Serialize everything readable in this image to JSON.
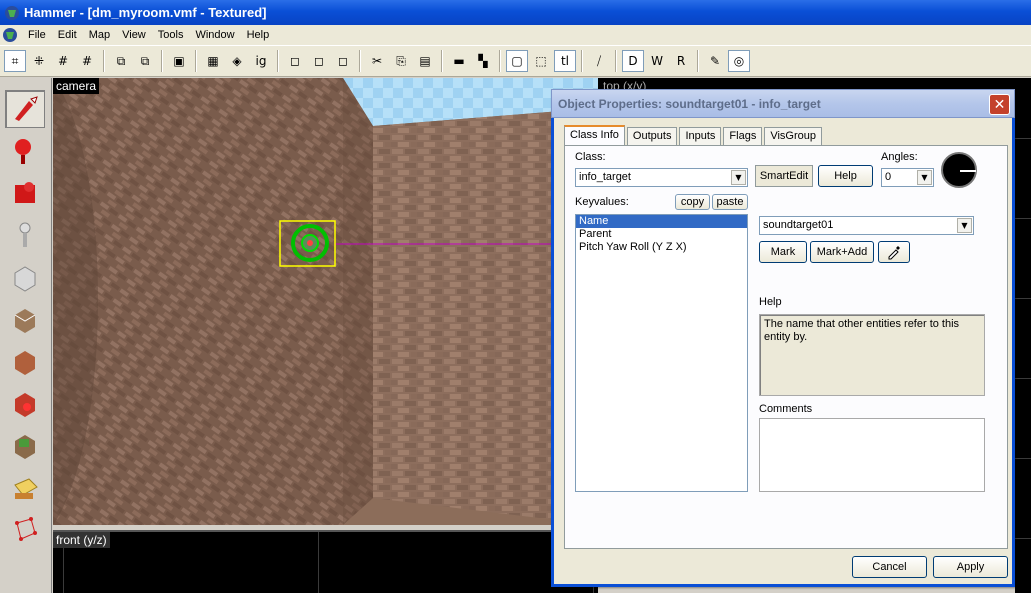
{
  "window": {
    "title": "Hammer - [dm_myroom.vmf - Textured]"
  },
  "menu": {
    "items": [
      "File",
      "Edit",
      "Map",
      "View",
      "Tools",
      "Window",
      "Help"
    ]
  },
  "toolbar": {
    "buttons": [
      {
        "name": "grid-toggle-icon",
        "glyph": "⌗",
        "pressed": true
      },
      {
        "name": "grid-dots-icon",
        "glyph": "⁜"
      },
      {
        "name": "grid-smaller-icon",
        "glyph": "#"
      },
      {
        "name": "grid-larger-icon",
        "glyph": "#"
      },
      {
        "name": "sep"
      },
      {
        "name": "carve-icon",
        "glyph": "⧉"
      },
      {
        "name": "hollow-icon",
        "glyph": "⧉"
      },
      {
        "name": "sep"
      },
      {
        "name": "group-icon",
        "glyph": "▣"
      },
      {
        "name": "sep"
      },
      {
        "name": "texture-lock-icon",
        "glyph": "▦"
      },
      {
        "name": "texture-scale-icon",
        "glyph": "◈"
      },
      {
        "name": "ignore-groups-icon",
        "glyph": "ig"
      },
      {
        "name": "sep"
      },
      {
        "name": "cordon-icon",
        "glyph": "◻"
      },
      {
        "name": "cordon-edit-icon",
        "glyph": "◻"
      },
      {
        "name": "cordon-toggle-icon",
        "glyph": "◻"
      },
      {
        "name": "sep"
      },
      {
        "name": "cut-icon",
        "glyph": "✂"
      },
      {
        "name": "copy-icon",
        "glyph": "⎘"
      },
      {
        "name": "paste-icon",
        "glyph": "▤"
      },
      {
        "name": "sep"
      },
      {
        "name": "hide-icon",
        "glyph": "▬"
      },
      {
        "name": "hide-unselected-icon",
        "glyph": "▚"
      },
      {
        "name": "sep"
      },
      {
        "name": "box-select-icon",
        "glyph": "▢",
        "pressed": true
      },
      {
        "name": "box-dashed-icon",
        "glyph": "⬚"
      },
      {
        "name": "tl-icon",
        "glyph": "tl",
        "pressed": true
      },
      {
        "name": "sep"
      },
      {
        "name": "compile-icon",
        "glyph": "⧸"
      },
      {
        "name": "sep"
      },
      {
        "name": "d-toggle-icon",
        "glyph": "D",
        "pressed": true
      },
      {
        "name": "w-toggle-icon",
        "glyph": "W"
      },
      {
        "name": "r-toggle-icon",
        "glyph": "R"
      },
      {
        "name": "sep"
      },
      {
        "name": "model-toggle-icon",
        "glyph": "✎"
      },
      {
        "name": "sphere-toggle-icon",
        "glyph": "◎",
        "pressed": true
      }
    ]
  },
  "tools": [
    {
      "name": "selection-tool-icon",
      "pressed": true
    },
    {
      "name": "magnify-tool-icon"
    },
    {
      "name": "camera-tool-icon"
    },
    {
      "name": "entity-tool-icon"
    },
    {
      "name": "block-tool-icon"
    },
    {
      "name": "toggle-texture-icon"
    },
    {
      "name": "apply-texture-icon"
    },
    {
      "name": "decal-tool-icon"
    },
    {
      "name": "overlay-tool-icon"
    },
    {
      "name": "clipping-tool-icon"
    },
    {
      "name": "vertex-tool-icon"
    }
  ],
  "views": {
    "camera_label": "camera",
    "front_label": "front (y/z)",
    "top_label": "top (x/y)"
  },
  "dialog": {
    "title": "Object Properties: soundtarget01 - info_target",
    "close_glyph": "✕",
    "tabs": [
      "Class Info",
      "Outputs",
      "Inputs",
      "Flags",
      "VisGroup"
    ],
    "class_label": "Class:",
    "class_value": "info_target",
    "smartedit_label": "SmartEdit",
    "help_button": "Help",
    "angles_label": "Angles:",
    "angles_value": "0",
    "keyvalues_label": "Keyvalues:",
    "copy_button": "copy",
    "paste_button": "paste",
    "keyvalues": [
      "Name",
      "Parent",
      "Pitch Yaw Roll (Y Z X)"
    ],
    "value_field": "soundtarget01",
    "mark_button": "Mark",
    "markadd_button": "Mark+Add",
    "help_label": "Help",
    "help_text": "The name that other entities refer to this entity by.",
    "comments_label": "Comments",
    "cancel_button": "Cancel",
    "apply_button": "Apply"
  }
}
